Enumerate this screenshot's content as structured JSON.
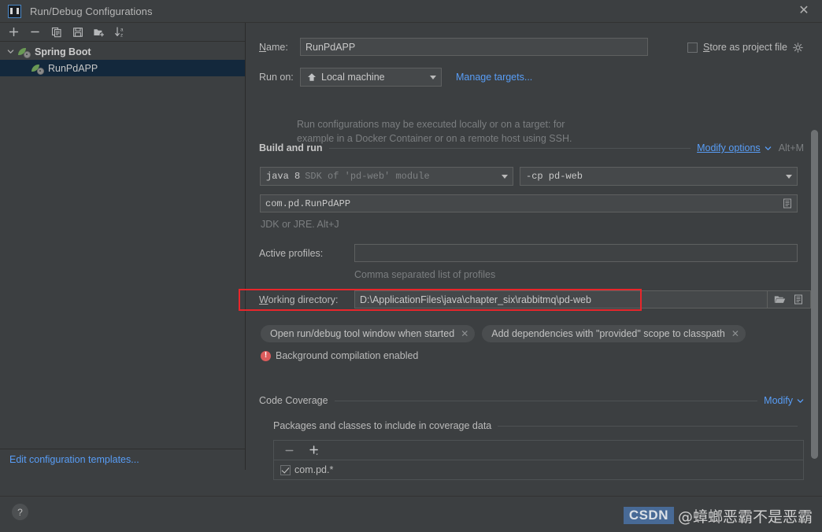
{
  "window": {
    "title": "Run/Debug Configurations",
    "close_label": "✕",
    "app_icon": "intellij-idea-icon"
  },
  "left_panel": {
    "toolbar": [
      {
        "name": "add-configuration-button",
        "icon": "plus-icon",
        "label": "+"
      },
      {
        "name": "remove-configuration-button",
        "icon": "minus-icon",
        "label": "−"
      },
      {
        "name": "copy-configuration-button",
        "icon": "copy-icon",
        "label": "Copy"
      },
      {
        "name": "save-configuration-button",
        "icon": "save-icon",
        "label": "Save"
      },
      {
        "name": "move-into-folder-button",
        "icon": "folder-add-icon",
        "label": "New Folder"
      },
      {
        "name": "sort-configurations-button",
        "icon": "sort-az-icon",
        "label": "Sort"
      }
    ],
    "tree": {
      "group": {
        "label": "Spring Boot",
        "icon": "spring-boot-icon",
        "expanded_icon": "chevron-down-icon"
      },
      "children": [
        {
          "label": "RunPdAPP",
          "icon": "spring-boot-icon",
          "selected": true
        }
      ]
    },
    "edit_templates_link": "Edit configuration templates..."
  },
  "form": {
    "name_label": "Name:",
    "name_label_mnemonic": "N",
    "name_value": "RunPdAPP",
    "store_as_project_file_label": "Store as project file",
    "store_as_project_file_mnemonic": "S",
    "store_as_project_file_checked": false,
    "store_gear_icon": "gear-icon",
    "run_on_label": "Run on:",
    "run_on_value": "Local machine",
    "run_on_icon": "local-machine-icon",
    "manage_targets_link": "Manage targets...",
    "run_on_description_line1": "Run configurations may be executed locally or on a target: for",
    "run_on_description_line2": "example in a Docker Container or on a remote host using SSH.",
    "build_and_run": {
      "section_title": "Build and run",
      "modify_options_link": "Modify options",
      "modify_options_shortcut": "Alt+M",
      "modify_options_icon": "chevron-down-icon",
      "jre_value_bold": "java 8",
      "jre_value_dim": "SDK of 'pd-web' module",
      "classpath_value": "-cp pd-web",
      "main_class_value": "com.pd.RunPdAPP",
      "main_class_expand_icon": "expand-editor-icon",
      "jdk_hint": "JDK or JRE. Alt+J"
    },
    "active_profiles_label": "Active profiles:",
    "active_profiles_value": "",
    "active_profiles_hint": "Comma separated list of profiles",
    "working_directory_label": "Working directory:",
    "working_directory_mnemonic": "W",
    "working_directory_value": "D:\\ApplicationFiles\\java\\chapter_six\\rabbitmq\\pd-web",
    "working_directory_browse_icon": "folder-open-icon",
    "working_directory_expand_icon": "expand-editor-icon",
    "highlight_color": "#e8262b",
    "option_chips": [
      {
        "label": "Open run/debug tool window when started",
        "remove_icon": "close-icon"
      },
      {
        "label": "Add dependencies with \"provided\" scope to classpath",
        "remove_icon": "close-icon"
      }
    ],
    "warning": {
      "icon": "error-circle-icon",
      "text": "Background compilation enabled"
    },
    "code_coverage": {
      "section_title": "Code Coverage",
      "modify_link": "Modify",
      "modify_icon": "chevron-down-icon",
      "sub_section_title": "Packages and classes to include in coverage data",
      "toolbar": [
        {
          "name": "remove-package-button",
          "icon": "minus-icon",
          "label": "−"
        },
        {
          "name": "add-package-button",
          "icon": "plus-dropdown-icon",
          "label": "+"
        }
      ],
      "items": [
        {
          "label": "com.pd.*",
          "checked": true
        }
      ]
    }
  },
  "scrollbar": {
    "name": "right-panel-scrollbar",
    "thumb_color": "#6e7173"
  },
  "help": {
    "label": "?"
  },
  "watermark": {
    "badge": "CSDN",
    "text": "@蟑螂恶霸不是恶霸"
  }
}
